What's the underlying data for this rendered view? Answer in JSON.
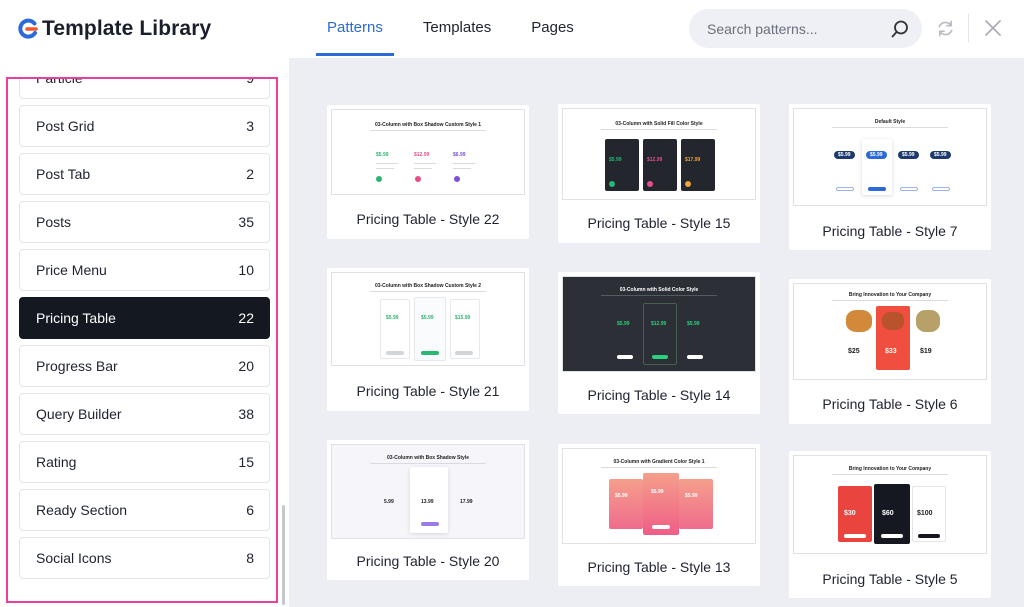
{
  "header": {
    "logo_text": "Template Library",
    "tabs": [
      {
        "label": "Patterns",
        "active": true
      },
      {
        "label": "Templates",
        "active": false
      },
      {
        "label": "Pages",
        "active": false
      }
    ],
    "search_placeholder": "Search patterns..."
  },
  "sidebar": {
    "items": [
      {
        "label": "Particle",
        "count": "9"
      },
      {
        "label": "Post Grid",
        "count": "3"
      },
      {
        "label": "Post Tab",
        "count": "2"
      },
      {
        "label": "Posts",
        "count": "35"
      },
      {
        "label": "Price Menu",
        "count": "10"
      },
      {
        "label": "Pricing Table",
        "count": "22",
        "active": true
      },
      {
        "label": "Progress Bar",
        "count": "20"
      },
      {
        "label": "Query Builder",
        "count": "38"
      },
      {
        "label": "Rating",
        "count": "15"
      },
      {
        "label": "Ready Section",
        "count": "6"
      },
      {
        "label": "Social Icons",
        "count": "8"
      }
    ]
  },
  "cards": [
    {
      "title": "Pricing Table - Style 22",
      "thumb_title": "03-Column with Box Shadow Custom Style 1",
      "thumb_prices": [
        "$5.99",
        "$12.99",
        "$6.99"
      ]
    },
    {
      "title": "Pricing Table - Style 15",
      "thumb_title": "03-Column with Solid Fill Color Style",
      "thumb_prices": [
        "$5.99",
        "$12.99",
        "$17.99"
      ]
    },
    {
      "title": "Pricing Table - Style 7",
      "thumb_title": "Default Style",
      "thumb_prices": [
        "$5.99",
        "$5.99",
        "$5.99",
        "$5.99"
      ]
    },
    {
      "title": "Pricing Table - Style 21",
      "thumb_title": "03-Column with Box Shadow Custom Style 2",
      "thumb_prices": [
        "$5.99",
        "$5.99",
        "$15.99"
      ]
    },
    {
      "title": "Pricing Table - Style 14",
      "thumb_title": "03-Column with Solid Color Style",
      "thumb_prices": [
        "$5.99",
        "$12.99",
        "$5.99"
      ]
    },
    {
      "title": "Pricing Table - Style 6",
      "thumb_title": "Bring Innovation to Your Company",
      "thumb_prices": [
        "$25",
        "$33",
        "$19"
      ]
    },
    {
      "title": "Pricing Table - Style 20",
      "thumb_title": "03-Column with Box Shadow Style",
      "thumb_prices": [
        "5.99",
        "13.99",
        "17.99"
      ]
    },
    {
      "title": "Pricing Table - Style 13",
      "thumb_title": "03-Column with Gradient Color Style 1",
      "thumb_prices": [
        "$5.99",
        "$5.99",
        "$5.99"
      ]
    },
    {
      "title": "Pricing Table - Style 5",
      "thumb_title": "Bring Innovation to Your Company",
      "thumb_prices": [
        "$30",
        "$60",
        "$100"
      ]
    }
  ],
  "colors": {
    "accent": "#2b6ad8",
    "highlight_border": "#ea3f9b",
    "active_item_bg": "#141820"
  },
  "icons": [
    "logo-icon",
    "search-icon",
    "refresh-icon",
    "close-icon"
  ]
}
